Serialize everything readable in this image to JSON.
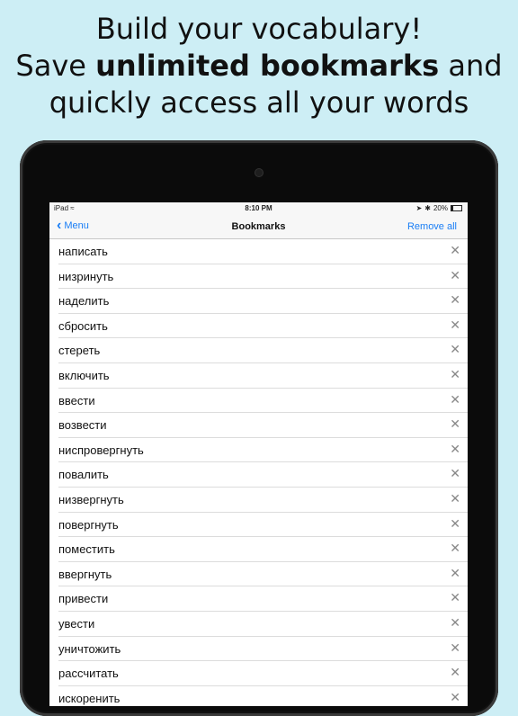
{
  "headline": {
    "line1": "Build your vocabulary!",
    "line2_pre": "Save ",
    "line2_bold": "unlimited bookmarks",
    "line2_post": " and",
    "line3": "quickly access all your words"
  },
  "status_bar": {
    "device": "iPad",
    "time": "8:10 PM",
    "battery": "20%"
  },
  "nav": {
    "back_label": "Menu",
    "title": "Bookmarks",
    "right_label": "Remove all"
  },
  "bookmarks": [
    "написать",
    "низринуть",
    "наделить",
    "сбросить",
    "стереть",
    "включить",
    "ввести",
    "возвести",
    "ниспровергнуть",
    "повалить",
    "низвергнуть",
    "повергнуть",
    "поместить",
    "ввергнуть",
    "привести",
    "увести",
    "уничтожить",
    "рассчитать",
    "искоренить"
  ],
  "icons": {
    "wifi": "wifi-icon",
    "location": "location-icon",
    "bluetooth": "bluetooth-icon",
    "battery": "battery-icon",
    "remove": "close-icon",
    "back": "chevron-left-icon"
  },
  "colors": {
    "background": "#cdeef5",
    "accent": "#1a7ef5"
  }
}
